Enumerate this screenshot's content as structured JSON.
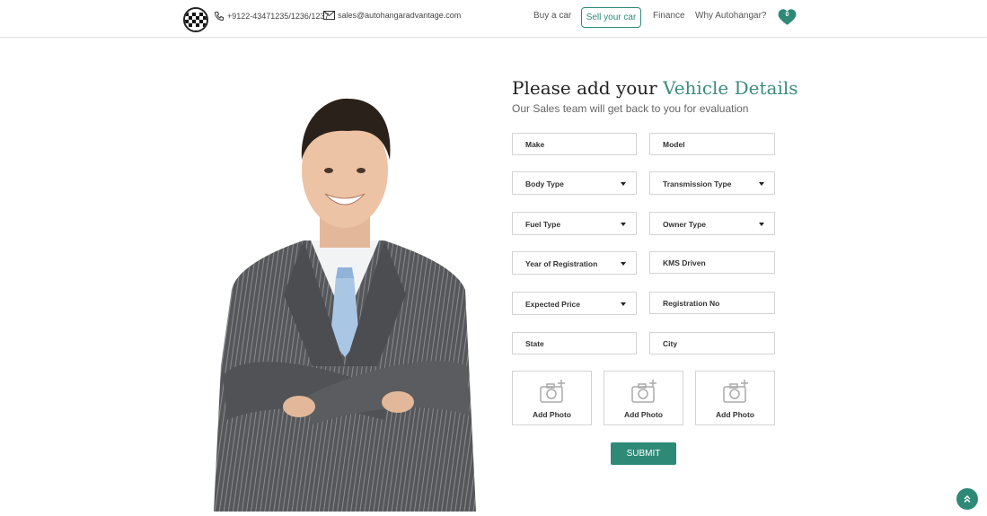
{
  "header": {
    "phone": "+9122-43471235/1236/1237",
    "email": "sales@autohangaradvantage.com",
    "nav": {
      "buy": "Buy a car",
      "sell": "Sell your car",
      "finance": "Finance",
      "why": "Why Autohangar?"
    },
    "wishlist_count": "0"
  },
  "form": {
    "title_main": "Please add your ",
    "title_accent": "Vehicle Details",
    "subtitle": "Our Sales team will get back to you for evaluation",
    "fields": {
      "make": "Make",
      "model": "Model",
      "body_type": "Body Type",
      "transmission_type": "Transmission Type",
      "fuel_type": "Fuel Type",
      "owner_type": "Owner Type",
      "year_of_registration": "Year of Registration",
      "kms_driven": "KMS Driven",
      "expected_price": "Expected Price",
      "registration_no": "Registration No",
      "state": "State",
      "city": "City"
    },
    "photos": [
      "Add Photo",
      "Add Photo",
      "Add Photo"
    ],
    "submit": "SUBMIT"
  },
  "colors": {
    "accent": "#2e8a77",
    "heading_accent": "#3a8d7a"
  },
  "icons": [
    "logo-icon",
    "phone-icon",
    "mail-icon",
    "heart-icon",
    "camera-add-icon",
    "chevron-up-icon"
  ]
}
